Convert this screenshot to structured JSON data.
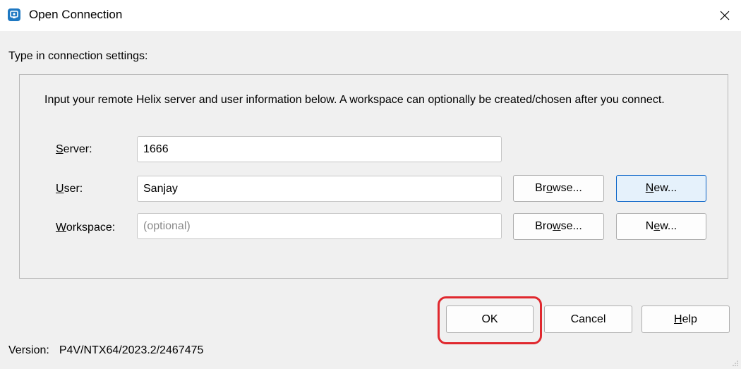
{
  "window": {
    "title": "Open Connection",
    "close_glyph": "✕"
  },
  "prompt": "Type in connection settings:",
  "description": "Input your remote Helix server and user information below. A workspace can optionally be created/chosen after you connect.",
  "form": {
    "server": {
      "label_key": "S",
      "label_rest": "erver:",
      "value": "1666"
    },
    "user": {
      "label_key": "U",
      "label_rest": "ser:",
      "value": "Sanjay"
    },
    "workspace": {
      "label_key": "W",
      "label_rest": "orkspace:",
      "value": "",
      "placeholder": "(optional)"
    }
  },
  "user_buttons": {
    "browse": {
      "pre": "Br",
      "key": "o",
      "post": "wse..."
    },
    "new": {
      "pre": "",
      "key": "N",
      "post": "ew..."
    }
  },
  "workspace_buttons": {
    "browse": {
      "pre": "Bro",
      "key": "w",
      "post": "se..."
    },
    "new": {
      "pre": "N",
      "key": "e",
      "post": "w..."
    }
  },
  "footer_buttons": {
    "ok": "OK",
    "cancel": "Cancel",
    "help_key": "H",
    "help_rest": "elp"
  },
  "version": {
    "label": "Version:",
    "value": "P4V/NTX64/2023.2/2467475"
  },
  "colors": {
    "accent": "#1e78c2",
    "highlight": "#e0282e",
    "background": "#f0f0f0"
  }
}
